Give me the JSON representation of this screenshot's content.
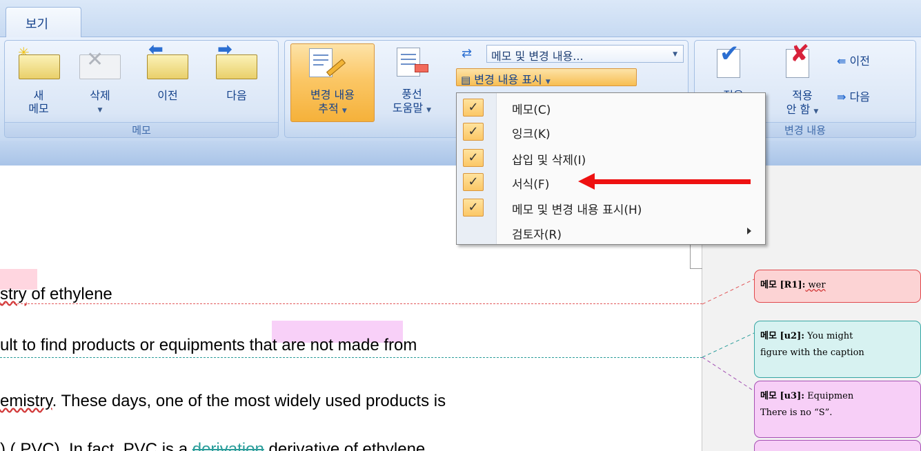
{
  "ribbon": {
    "tab_label": "보기",
    "groups": {
      "memo": {
        "label": "메모",
        "new_line1": "새",
        "new_line2": "메모",
        "delete": "삭제",
        "prev": "이전",
        "next": "다음"
      },
      "tracking": {
        "track_line1": "변경 내용",
        "track_line2": "추적",
        "balloon_line1": "풍선",
        "balloon_line2": "도움말",
        "display_combo": "메모 및 변경 내용...",
        "show_markup": "변경 내용 표시"
      },
      "changes": {
        "label": "변경 내용",
        "accept_line1": "적용",
        "reject_line1": "적용",
        "reject_line2": "안 함",
        "prev": "이전",
        "next": "다음"
      }
    }
  },
  "menu": {
    "items": [
      {
        "label": "메모(C)",
        "checked": true
      },
      {
        "label": "잉크(K)",
        "checked": true
      },
      {
        "label": "삽입 및 삭제(I)",
        "checked": true
      },
      {
        "label": "서식(F)",
        "checked": true
      },
      {
        "label": "메모 및 변경 내용 표시(H)",
        "checked": true
      },
      {
        "label": "검토자(R)",
        "checked": false,
        "submenu": true
      }
    ],
    "check_glyph": "✓"
  },
  "document": {
    "line1_a": "stry",
    "line1_b": " of ethylene",
    "line2_a": "ult to find products or ",
    "line2_b": "equipments",
    "line2_c": " that are not made from",
    "line3_a": "emistry",
    "line3_b": ". These days, one of the most widely used products is",
    "line4_a": ") ( PVC). In fact, PVC is a ",
    "line4_b": "derivation",
    "line4_c": " derivative of ethylene"
  },
  "balloons": [
    {
      "tag": "메모 [R1]:",
      "text": " wer",
      "text2": ""
    },
    {
      "tag": "메모 [u2]:",
      "text": " You might",
      "text2": "figure with the caption"
    },
    {
      "tag": "메모 [u3]:",
      "text": " Equipmen",
      "text2": "There is no “S”."
    },
    {
      "tag": "",
      "text": "",
      "text2": ""
    }
  ],
  "colors": {
    "accent_active": "#fbc766",
    "arrow": "#ee1111",
    "change_teal": "#2a9d9a",
    "comment_red": "#e0484c",
    "comment_violet": "#a54fb3"
  }
}
